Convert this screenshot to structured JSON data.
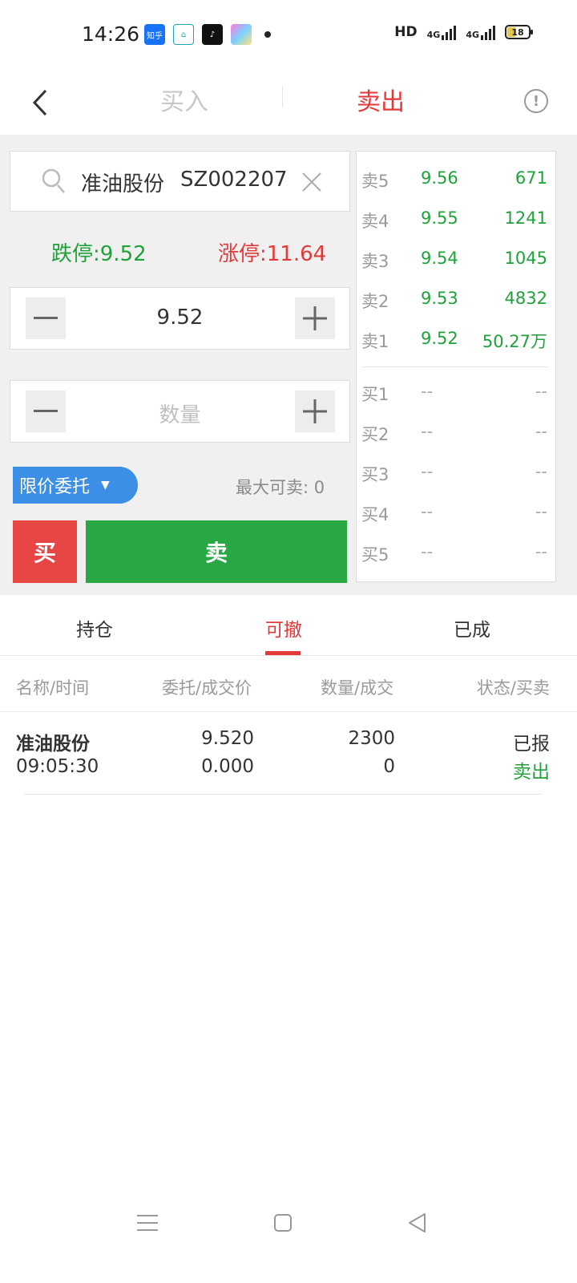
{
  "status_bar": {
    "time": "14:26",
    "zhihu_label": "知乎",
    "net_label": "HD",
    "sig1_label": "4G",
    "sig2_label": "4G",
    "battery": "18"
  },
  "header": {
    "tab_buy": "买入",
    "tab_sell": "卖出",
    "info_glyph": "!"
  },
  "stock": {
    "name": "准油股份",
    "code": "SZ002207",
    "limit_down": "跌停:9.52",
    "limit_up": "涨停:11.64"
  },
  "price_input": {
    "value": "9.52"
  },
  "quantity_input": {
    "placeholder": "数量"
  },
  "order_type": "限价委托",
  "max_sell": "最大可卖: 0",
  "buttons": {
    "buy": "买",
    "sell": "卖"
  },
  "order_book": {
    "asks": [
      {
        "label": "卖5",
        "price": "9.56",
        "volume": "671"
      },
      {
        "label": "卖4",
        "price": "9.55",
        "volume": "1241"
      },
      {
        "label": "卖3",
        "price": "9.54",
        "volume": "1045"
      },
      {
        "label": "卖2",
        "price": "9.53",
        "volume": "4832"
      },
      {
        "label": "卖1",
        "price": "9.52",
        "volume": "50.27万"
      }
    ],
    "bids": [
      {
        "label": "买1",
        "price": "--",
        "volume": "--"
      },
      {
        "label": "买2",
        "price": "--",
        "volume": "--"
      },
      {
        "label": "买3",
        "price": "--",
        "volume": "--"
      },
      {
        "label": "买4",
        "price": "--",
        "volume": "--"
      },
      {
        "label": "买5",
        "price": "--",
        "volume": "--"
      }
    ]
  },
  "order_tabs": [
    "持仓",
    "可撤",
    "已成"
  ],
  "columns": [
    "名称/时间",
    "委托/成交价",
    "数量/成交",
    "状态/买卖"
  ],
  "orders": [
    {
      "name": "准油股份",
      "time": "09:05:30",
      "order_price": "9.520",
      "deal_price": "0.000",
      "quantity": "2300",
      "deal_quantity": "0",
      "status": "已报",
      "side": "卖出"
    }
  ],
  "colors": {
    "accent_red": "#e23a3a",
    "green": "#1fa23a",
    "blue": "#3b8fe6"
  }
}
